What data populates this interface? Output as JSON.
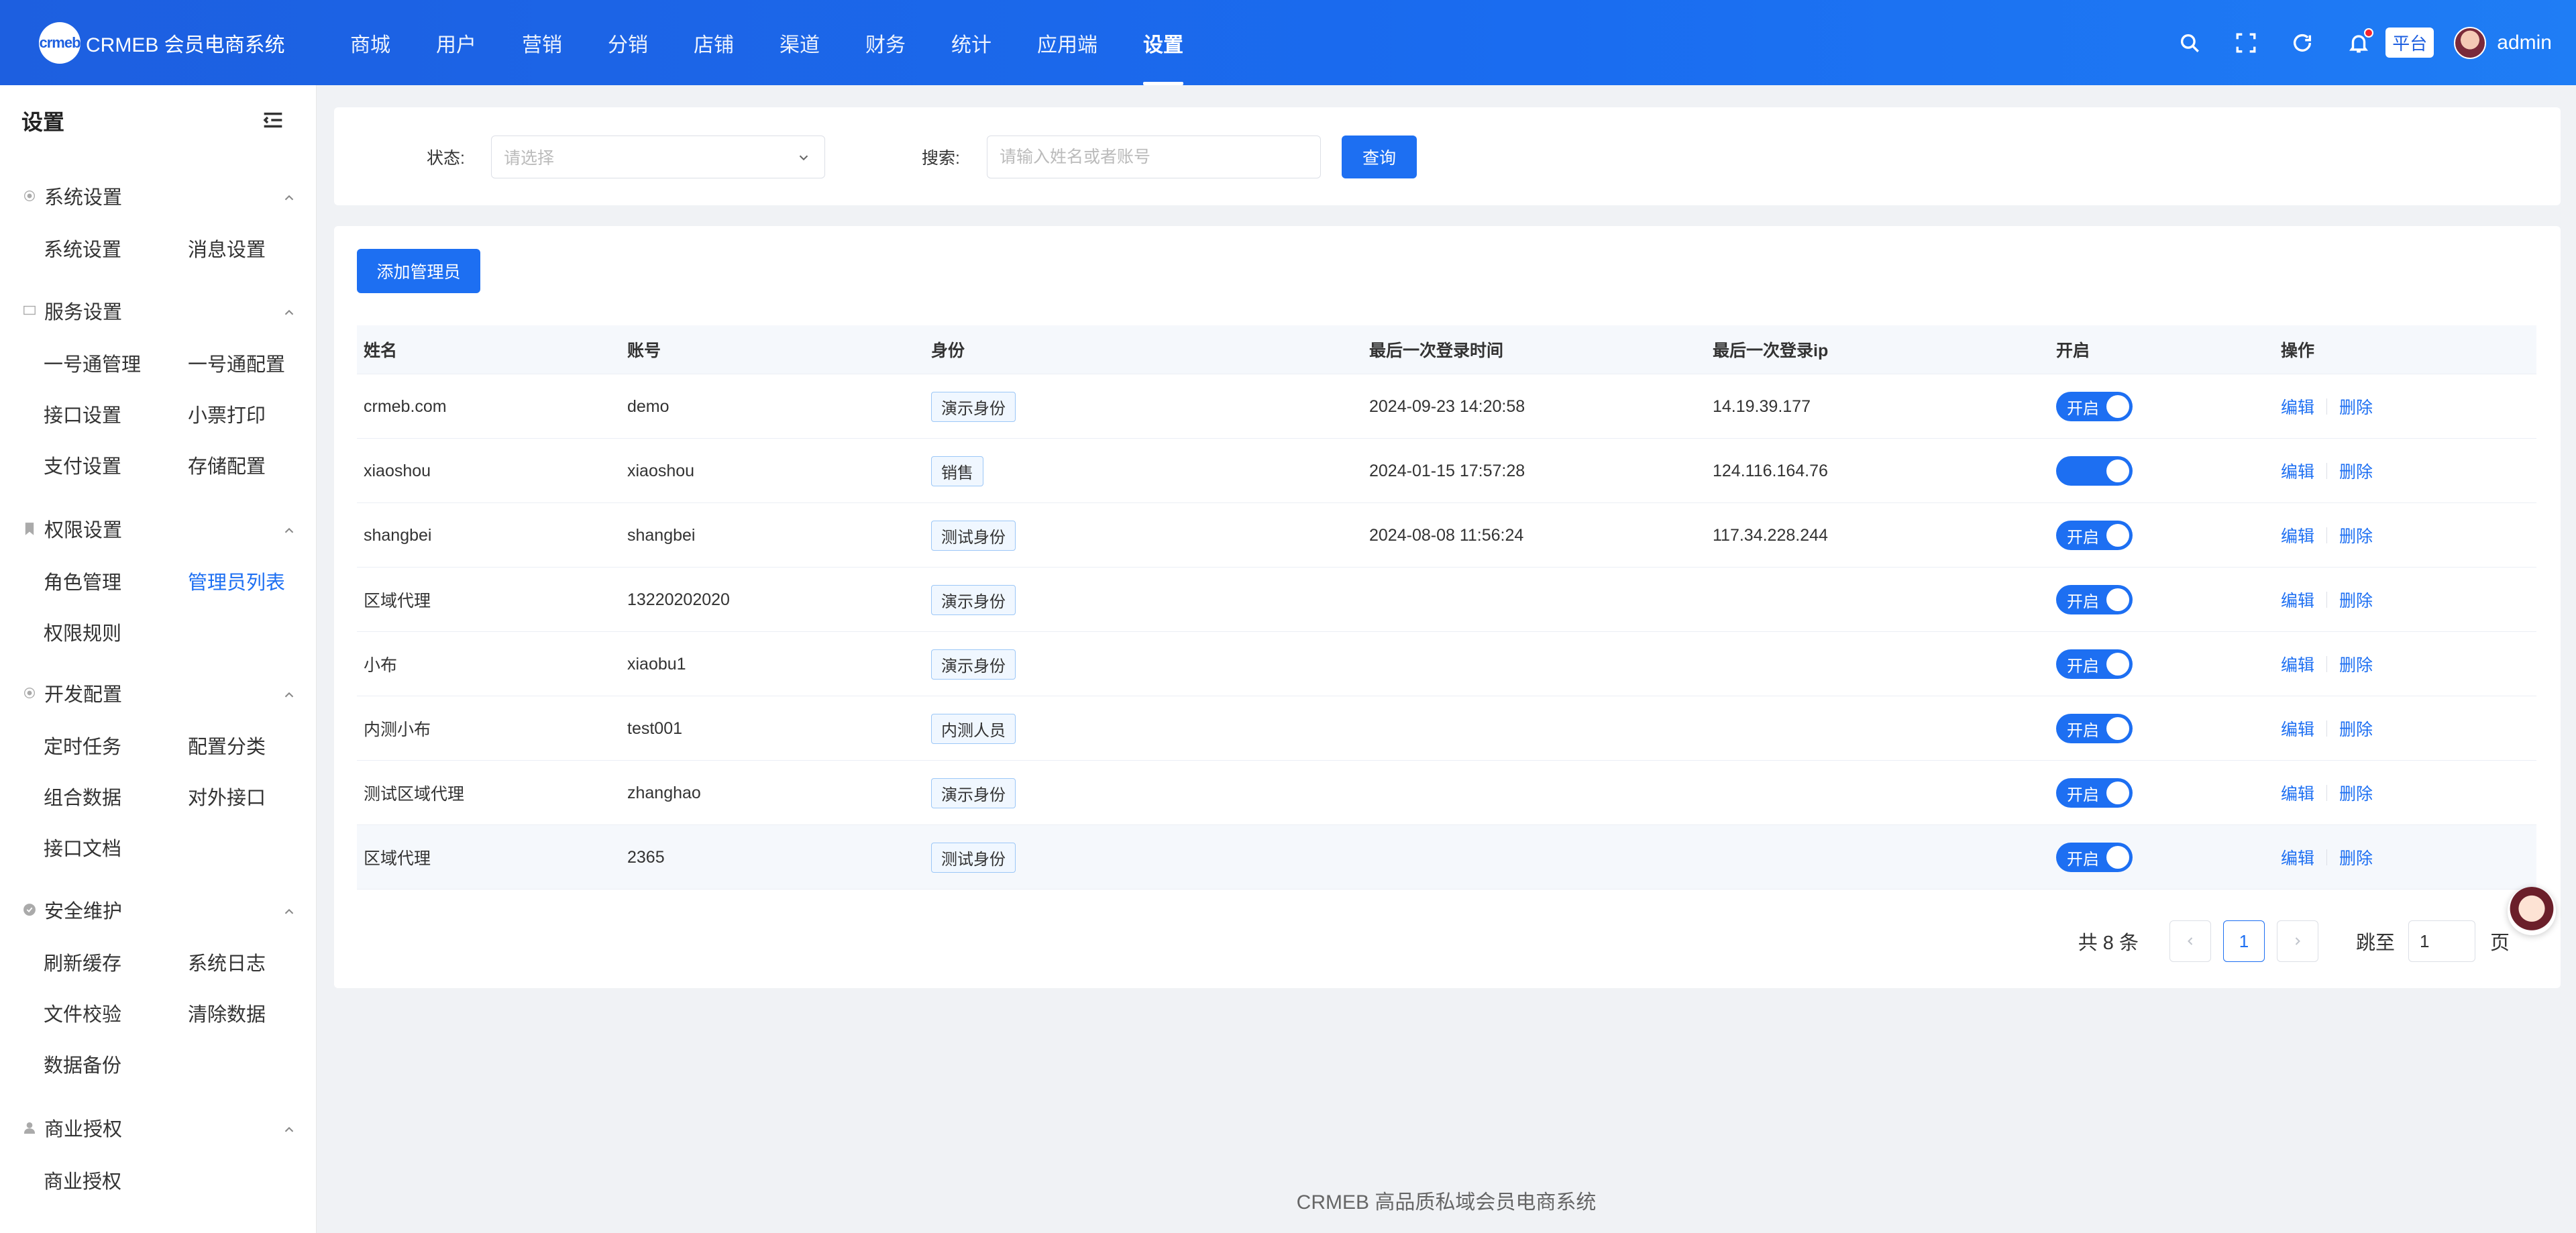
{
  "brand": {
    "logo_mark": "crmeb",
    "name": "CRMEB 会员电商系统"
  },
  "topnav": [
    {
      "label": "商城"
    },
    {
      "label": "用户"
    },
    {
      "label": "营销"
    },
    {
      "label": "分销"
    },
    {
      "label": "店铺"
    },
    {
      "label": "渠道"
    },
    {
      "label": "财务"
    },
    {
      "label": "统计"
    },
    {
      "label": "应用端"
    },
    {
      "label": "设置",
      "active": true
    }
  ],
  "header": {
    "platform_tag": "平台",
    "username": "admin",
    "icons": [
      "search-icon",
      "fullscreen-icon",
      "refresh-icon",
      "bell-icon"
    ]
  },
  "sidebar": {
    "title": "设置",
    "groups": [
      {
        "label": "系统设置",
        "icon": "gear-icon",
        "items": [
          "系统设置",
          "消息设置"
        ]
      },
      {
        "label": "服务设置",
        "icon": "monitor-icon",
        "items": [
          "一号通管理",
          "一号通配置",
          "接口设置",
          "小票打印",
          "支付设置",
          "存储配置"
        ]
      },
      {
        "label": "权限设置",
        "icon": "bookmark-icon",
        "items": [
          "角色管理",
          "管理员列表",
          "权限规则"
        ]
      },
      {
        "label": "开发配置",
        "icon": "gear-icon",
        "items": [
          "定时任务",
          "配置分类",
          "组合数据",
          "对外接口",
          "接口文档"
        ]
      },
      {
        "label": "安全维护",
        "icon": "shield-check-icon",
        "items": [
          "刷新缓存",
          "系统日志",
          "文件校验",
          "清除数据",
          "数据备份"
        ]
      },
      {
        "label": "商业授权",
        "icon": "user-icon",
        "items": [
          "商业授权"
        ]
      }
    ],
    "active_item": "管理员列表"
  },
  "filter": {
    "status_label": "状态:",
    "status_placeholder": "请选择",
    "search_label": "搜索:",
    "search_placeholder": "请输入姓名或者账号",
    "query_label": "查询"
  },
  "table": {
    "add_label": "添加管理员",
    "columns": [
      "姓名",
      "账号",
      "身份",
      "最后一次登录时间",
      "最后一次登录ip",
      "开启",
      "操作"
    ],
    "rows": [
      {
        "name": "crmeb.com",
        "account": "demo",
        "role": "演示身份",
        "last_time": "2024-09-23 14:20:58",
        "last_ip": "14.19.39.177",
        "status": "开启"
      },
      {
        "name": "xiaoshou",
        "account": "xiaoshou",
        "role": "销售",
        "last_time": "2024-01-15 17:57:28",
        "last_ip": "124.116.164.76",
        "status": ""
      },
      {
        "name": "shangbei",
        "account": "shangbei",
        "role": "测试身份",
        "last_time": "2024-08-08 11:56:24",
        "last_ip": "117.34.228.244",
        "status": "开启"
      },
      {
        "name": "区域代理",
        "account": "13220202020",
        "role": "演示身份",
        "last_time": "",
        "last_ip": "",
        "status": "开启"
      },
      {
        "name": "小布",
        "account": "xiaobu1",
        "role": "演示身份",
        "last_time": "",
        "last_ip": "",
        "status": "开启"
      },
      {
        "name": "内测小布",
        "account": "test001",
        "role": "内测人员",
        "last_time": "",
        "last_ip": "",
        "status": "开启"
      },
      {
        "name": "测试区域代理",
        "account": "zhanghao",
        "role": "演示身份",
        "last_time": "",
        "last_ip": "",
        "status": "开启"
      },
      {
        "name": "区域代理",
        "account": "2365",
        "role": "测试身份",
        "last_time": "",
        "last_ip": "",
        "status": "开启"
      }
    ],
    "edit_label": "编辑",
    "delete_label": "删除"
  },
  "pagination": {
    "total_text": "共 8 条",
    "current_page": "1",
    "jump_label": "跳至",
    "jump_value": "1",
    "page_suffix": "页"
  },
  "footer": {
    "text": "CRMEB 高品质私域会员电商系统"
  },
  "colors": {
    "primary": "#1d6ff2",
    "header_start": "#1d5fe0",
    "header_end": "#1f7df5",
    "notify_dot": "#f5222d"
  }
}
